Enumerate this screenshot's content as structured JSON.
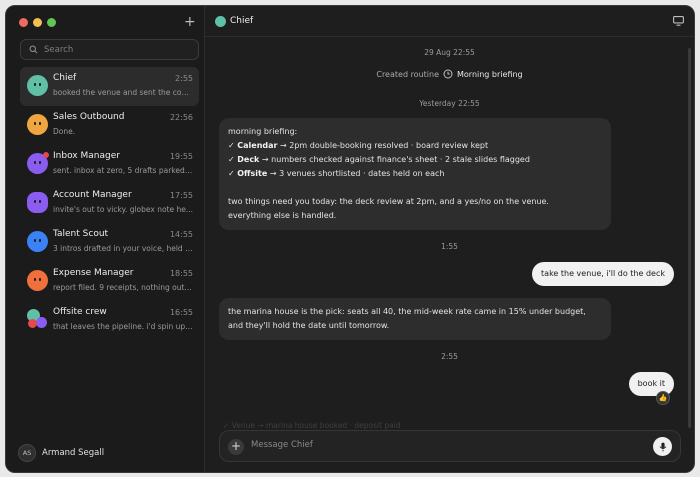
{
  "sidebar": {
    "traffic_colors": [
      "#ed6a5e",
      "#f5bf4f",
      "#61c454"
    ],
    "new_chat_label": "+",
    "search_placeholder": "Search",
    "chats": [
      {
        "name": "Chief",
        "time": "2:55",
        "preview": "booked the venue and sent the con...",
        "color": "#5fbfa7",
        "active": true
      },
      {
        "name": "Sales Outbound",
        "time": "22:56",
        "preview": "Done.",
        "color": "#f0a640"
      },
      {
        "name": "Inbox Manager",
        "time": "19:55",
        "preview": "sent. inbox at zero, 5 drafts parked ...",
        "color": "#8a5cf0"
      },
      {
        "name": "Account Manager",
        "time": "17:55",
        "preview": "invite's out to vicky. globex note he...",
        "color": "#8a5cf0"
      },
      {
        "name": "Talent Scout",
        "time": "14:55",
        "preview": "3 intros drafted in your voice, held f...",
        "color": "#3b82f6"
      },
      {
        "name": "Expense Manager",
        "time": "18:55",
        "preview": "report filed. 9 receipts, nothing out...",
        "color": "#f0703c"
      },
      {
        "name": "Offsite crew",
        "time": "16:55",
        "preview": "that leaves the pipeline. i'd spin up ...",
        "color": "#5fbfa7"
      }
    ],
    "user": {
      "initials": "AS",
      "name": "Armand Segall"
    }
  },
  "header": {
    "title": "Chief",
    "icon": "monitor-icon"
  },
  "messages": {
    "stamp_1": "29 Aug 22:55",
    "routine_prefix": "Created routine",
    "routine_name": "Morning briefing",
    "stamp_2": "Yesterday 22:55",
    "briefing": {
      "line1": "morning briefing:",
      "items": [
        {
          "check": "✓",
          "label": "Calendar",
          "text": " → 2pm double-booking resolved · board review kept"
        },
        {
          "check": "✓",
          "label": "Deck",
          "text": " → numbers checked against finance's sheet · 2 stale slides flagged"
        },
        {
          "check": "✓",
          "label": "Offsite",
          "text": " → 3 venues shortlisted · dates held on each"
        }
      ],
      "para1": "two things need you today: the deck review at 2pm, and a yes/no on the venue.",
      "para2": "everything else is handled."
    },
    "stamp_3": "1:55",
    "reply_1": "take the venue, i'll do the deck",
    "marina_1": "the marina house is the pick: seats all 40, the mid-week rate came in 15% under budget,",
    "marina_2": "and they'll hold the date until tomorrow.",
    "stamp_4": "2:55",
    "reply_2": "book it",
    "reaction": "👍",
    "faded": "✓ Venue → marina house booked · deposit paid"
  },
  "composer": {
    "placeholder": "Message Chief"
  }
}
